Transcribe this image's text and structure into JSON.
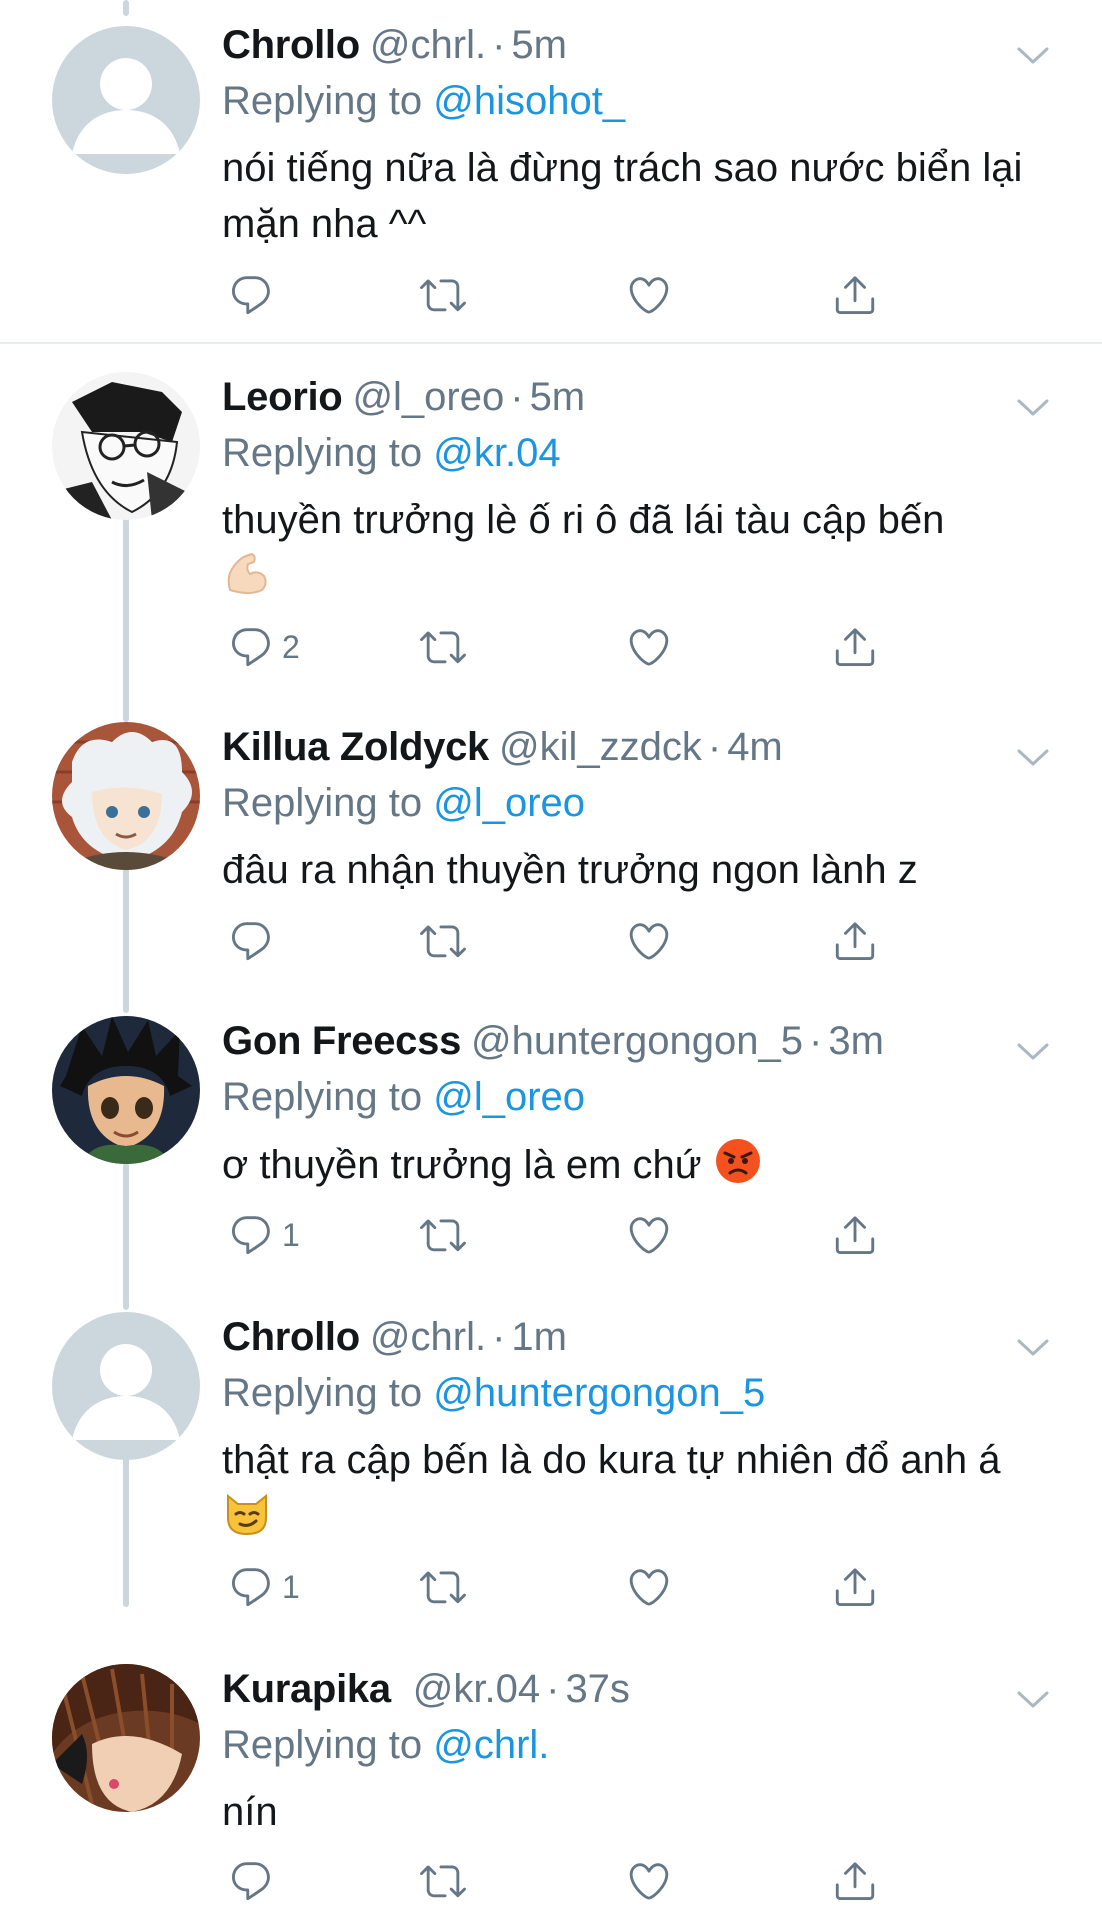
{
  "tweets": [
    {
      "name": "Chrollo",
      "handle": "@chrl.",
      "dot": "·",
      "time": "5m",
      "replying_label": "Replying to",
      "replying_to": "@hisohot_",
      "text": "nói tiếng nữa là đừng trách sao nước biển lại mặn nha ^^",
      "reply_count": "",
      "avatar": "default-avatar"
    },
    {
      "name": "Leorio",
      "handle": "@l_oreo",
      "dot": "·",
      "time": "5m",
      "replying_label": "Replying to",
      "replying_to": "@kr.04",
      "text": "thuyền trưởng lè ố ri ô đã lái tàu cập bến",
      "reply_count": "2",
      "avatar": "manga-glasses-avatar",
      "emoji": "flexed-biceps-emoji"
    },
    {
      "name": "Killua Zoldyck",
      "handle": "@kil_zzdck",
      "dot": "·",
      "time": "4m",
      "replying_label": "Replying to",
      "replying_to": "@l_oreo",
      "text": "đâu ra nhận thuyền trưởng ngon lành z",
      "reply_count": "",
      "avatar": "white-hair-anime-avatar"
    },
    {
      "name": "Gon Freecss",
      "handle": "@huntergongon_5",
      "dot": "·",
      "time": "3m",
      "replying_label": "Replying to",
      "replying_to": "@l_oreo",
      "text": "ơ thuyền trưởng là em chứ",
      "reply_count": "1",
      "avatar": "black-hair-anime-avatar",
      "emoji": "angry-face-emoji"
    },
    {
      "name": "Chrollo",
      "handle": "@chrl.",
      "dot": "·",
      "time": "1m",
      "replying_label": "Replying to",
      "replying_to": "@huntergongon_5",
      "text": "thật ra cập bến là do kura tự nhiên đổ anh á",
      "reply_count": "1",
      "avatar": "default-avatar",
      "emoji": "smirking-cat-emoji"
    },
    {
      "name": "Kurapika",
      "handle": "@kr.04",
      "dot": "·",
      "time": "37s",
      "replying_label": "Replying to",
      "replying_to": "@chrl.",
      "text": "nín",
      "reply_count": "",
      "avatar": "brown-hair-anime-avatar"
    }
  ],
  "colors": {
    "link": "#1b95e0",
    "muted": "#657786",
    "text": "#14171a",
    "line": "#ccd6dd",
    "divider": "#e6ecf0"
  },
  "icons": {
    "reply": "reply-icon",
    "retweet": "retweet-icon",
    "like": "like-icon",
    "share": "share-icon",
    "more": "chevron-down-icon"
  }
}
